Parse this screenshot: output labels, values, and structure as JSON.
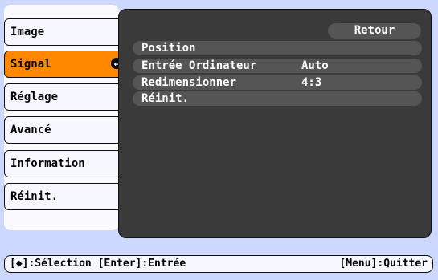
{
  "menu": {
    "items": [
      {
        "label": "Image"
      },
      {
        "label": "Signal"
      },
      {
        "label": "Réglage"
      },
      {
        "label": "Avancé"
      },
      {
        "label": "Information"
      },
      {
        "label": "Réinit."
      }
    ],
    "selected_index": 1
  },
  "submenu": {
    "retour_label": "Retour",
    "rows": [
      {
        "label": "Position",
        "value": ""
      },
      {
        "label": "Entrée Ordinateur",
        "value": "Auto"
      },
      {
        "label": "Redimensionner",
        "value": "4:3"
      },
      {
        "label": "Réinit.",
        "value": ""
      }
    ]
  },
  "help": {
    "left": "[◆]:Sélection [Enter]:Entrée",
    "right": "[Menu]:Quitter"
  },
  "colors": {
    "background": "#ccd8ff",
    "selected": "#ff8800",
    "panel": "#3a3a3a",
    "row": "#555555"
  }
}
